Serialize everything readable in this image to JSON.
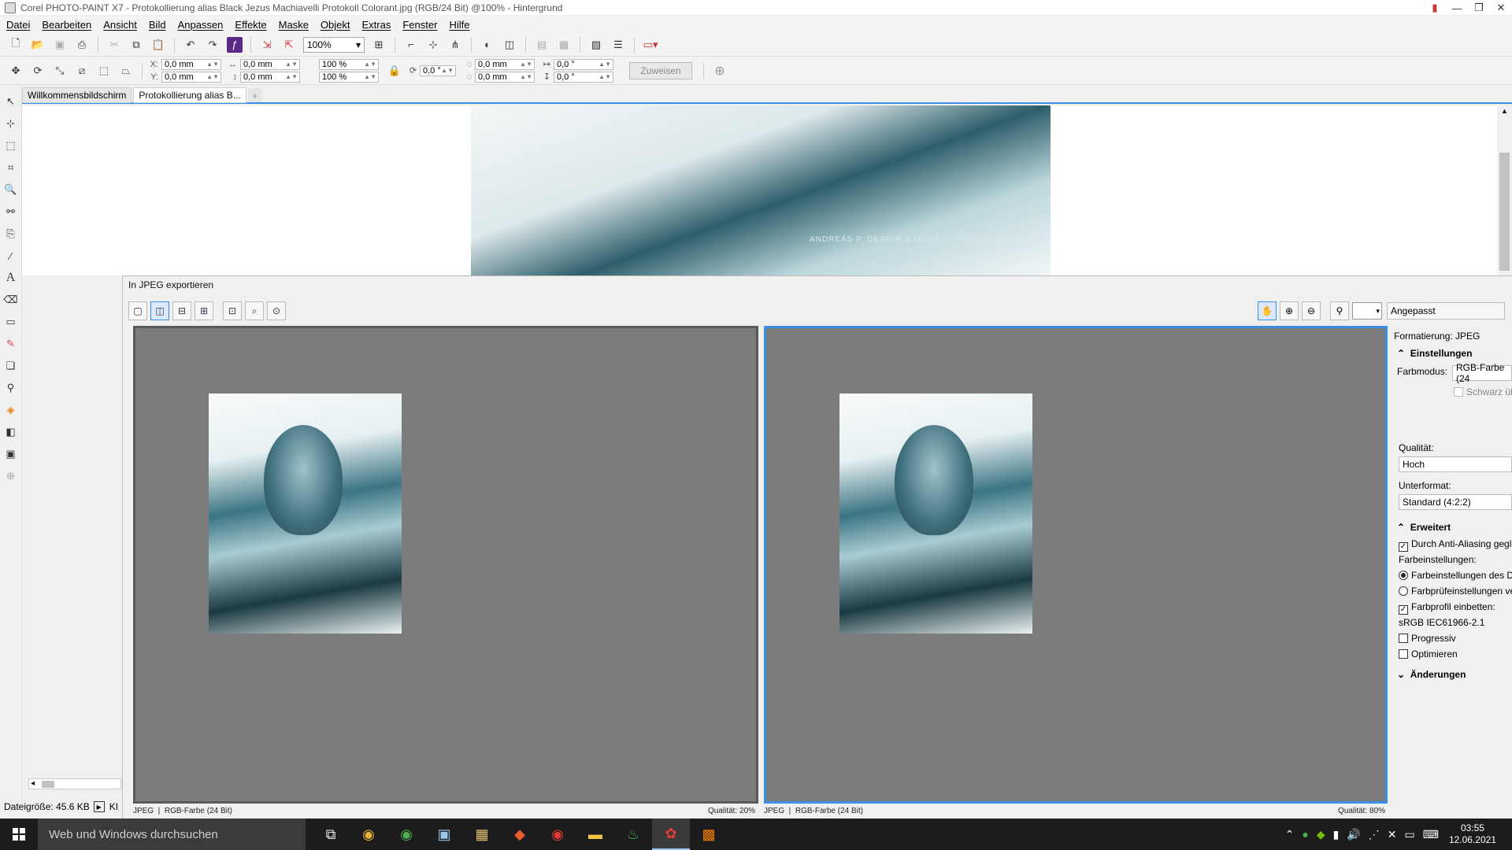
{
  "window": {
    "title": "Corel PHOTO-PAINT X7 - Protokollierung alias Black Jezus Machiavelli Protokoll Colorant.jpg (RGB/24 Bit) @100% - Hintergrund"
  },
  "menu": [
    "Datei",
    "Bearbeiten",
    "Ansicht",
    "Bild",
    "Anpassen",
    "Effekte",
    "Maske",
    "Objekt",
    "Extras",
    "Fenster",
    "Hilfe"
  ],
  "toolbar": {
    "zoom": "100%",
    "x_label": "X:",
    "x_value": "0,0 mm",
    "y_label": "Y:",
    "y_value": "0,0 mm",
    "w_value": "0,0 mm",
    "h_value": "0,0 mm",
    "scale_w": "100 %",
    "scale_h": "100 %",
    "rotate": "0,0 °",
    "cx": "0,0 mm",
    "cy": "0,0 mm",
    "skew_h": "0,0 °",
    "skew_v": "0,0 °",
    "assign": "Zuweisen"
  },
  "tabs": [
    "Willkommensbildschirm",
    "Protokollierung alias B..."
  ],
  "canvas": {
    "watermark": "ANDREAS P. DESIGN & MODELLIERUNGS CORP LTD"
  },
  "dialog": {
    "title": "In JPEG exportieren",
    "preset": "Angepasst",
    "left_status": {
      "format": "JPEG",
      "mode": "RGB-Farbe (24 Bit)",
      "quality": "Qualität: 20%"
    },
    "right_status": {
      "format": "JPEG",
      "mode": "RGB-Farbe (24 Bit)",
      "quality": "Qualität: 80%"
    },
    "panel": {
      "formatting": "Formatierung:  JPEG",
      "settings_header": "Einstellungen",
      "color_mode_label": "Farbmodus:",
      "color_mode_value": "RGB-Farbe (24",
      "black_label": "Schwarz üb",
      "quality_label": "Qualität:",
      "quality_value": "Hoch",
      "subformat_label": "Unterformat:",
      "subformat_value": "Standard (4:2:2)",
      "advanced_header": "Erweitert",
      "antialias": "Durch Anti-Aliasing gegl",
      "color_settings_label": "Farbeinstellungen:",
      "radio_doc": "Farbeinstellungen des D",
      "radio_proof": "Farbprüfeinstellungen ve",
      "embed_profile": "Farbprofil einbetten:",
      "profile": "sRGB IEC61966-2.1",
      "progressive": "Progressiv",
      "optimize": "Optimieren",
      "changes_header": "Änderungen"
    }
  },
  "status": {
    "filesize": "Dateigröße: 45.6 KB",
    "extra": "KI"
  },
  "taskbar": {
    "search_placeholder": "Web und Windows durchsuchen",
    "time": "03:55",
    "date": "12.06.2021"
  }
}
